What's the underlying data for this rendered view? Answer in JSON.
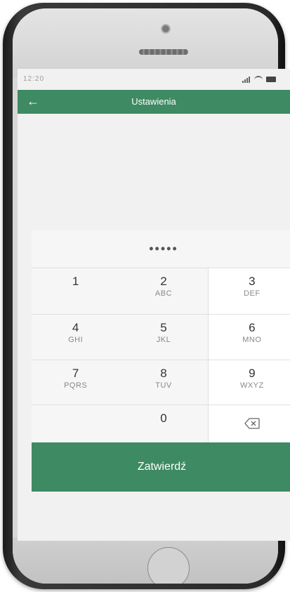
{
  "status_bar": {
    "time": "12:20",
    "signal_icon": "signal-icon",
    "wifi_icon": "wifi-icon",
    "battery_icon": "battery-icon"
  },
  "app_bar": {
    "back_icon": "arrow-left-icon",
    "back_glyph": "←",
    "title": "Ustawienia"
  },
  "pin": {
    "masked_value": "•••••"
  },
  "keypad": {
    "keys": [
      {
        "digit": "1",
        "letters": ""
      },
      {
        "digit": "2",
        "letters": "ABC"
      },
      {
        "digit": "3",
        "letters": "DEF"
      },
      {
        "digit": "4",
        "letters": "GHI"
      },
      {
        "digit": "5",
        "letters": "JKL"
      },
      {
        "digit": "6",
        "letters": "MNO"
      },
      {
        "digit": "7",
        "letters": "PQRS"
      },
      {
        "digit": "8",
        "letters": "TUV"
      },
      {
        "digit": "9",
        "letters": "WXYZ"
      },
      {
        "digit": "0",
        "letters": ""
      }
    ],
    "backspace_icon": "backspace-icon"
  },
  "confirm_button": {
    "label": "Zatwierdź"
  },
  "colors": {
    "accent": "#3e8a62",
    "screen_bg": "#f1f1f1",
    "keypad_bg": "#f6f6f6"
  }
}
